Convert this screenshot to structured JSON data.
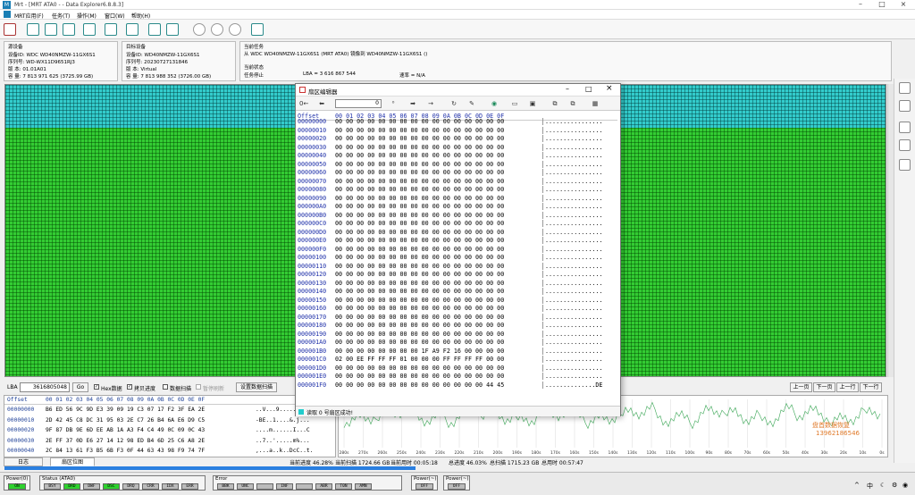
{
  "window": {
    "title": "Mrt - [MRT ATA0 -  - Data Explorer6.8.8.3]"
  },
  "menu": [
    "MRT应用(F)",
    "任务(T)",
    "操作(M)",
    "窗口(W)",
    "帮助(H)"
  ],
  "source": {
    "header": "源设备",
    "device_id": "设备ID: WDC WD40NMZW-11GX6S1",
    "serial": "序列号: WD-WX11D9651RJ3",
    "version": "版    本: 01.01A01",
    "capacity": "容    量: 7 813 971 625 (3725.99 GB)"
  },
  "target": {
    "header": "目标设备",
    "device_id": "设备ID: WD40NMZW-11GX6S1",
    "serial": "序列号: 20230727131846",
    "version": "版    本: Virtual",
    "capacity": "容    量: 7 813 988 352 (3726.00 GB)"
  },
  "task": {
    "header": "当前任务",
    "desc": "从 WDC WD40NMZW-11GX6S1 (MRT ATA0) 镜像到 WD40NMZW-11GX6S1 ()",
    "status_header": "当前状态",
    "status": "任务停止",
    "lba": "LBA = 3 616 867 544",
    "speed": "速率 = N/A"
  },
  "controls": {
    "lba_label": "LBA",
    "lba_value": "3616805048",
    "go": "Go",
    "hex_data": "Hex数据",
    "copy_progress": "拷贝进度",
    "data_scan": "数据扫描",
    "pause_refresh": "暂停刷新",
    "set_scan": "设置数据扫描",
    "prev_page": "上一页",
    "next_page": "下一页",
    "prev_row": "上一行",
    "next_row": "下一行"
  },
  "hex_bottom": {
    "header_offset": "Offset",
    "header_cols": "00 01 02 03 04 05 06 07 08 09 0A 0B 0C 0D 0E 0F",
    "rows": [
      {
        "off": "00000000",
        "hex": "B6 ED 56 9C 9D E3 39 09 19 C3 07 17 F2 3F EA 2E",
        "asc": "..V...9......?.."
      },
      {
        "off": "00000010",
        "hex": "2D 42 45 C8 DC 31 95 03 2E C7 26 B4 6A E6 D9 C5",
        "asc": "-BE..1....&.j..."
      },
      {
        "off": "00000020",
        "hex": "9F 87 DB 9E 6D EE AB 1A A3 F4 C4 49 0C 09 0C 43",
        "asc": "....m......I...C"
      },
      {
        "off": "00000030",
        "hex": "2E FF 37 0D E6 27 14 12 98 ED B4 6D 25 C6 A8 2E",
        "asc": "..7..'.....m%..."
      },
      {
        "off": "00000040",
        "hex": "2C 84 13 61 F3 B5 6B F3 0F 44 63 43 98 F9 74 7F",
        "asc": ",...a..k..DcC..t."
      }
    ]
  },
  "tabs": [
    "日志",
    "扇区位图"
  ],
  "status": {
    "cur_progress": "当前进度  46.28%",
    "cur_scan": "当前扫描  1724.66 GB",
    "cur_time": "当前用时  00:05:18",
    "total_progress": "总进度  46.03%",
    "total_scan": "总扫描  1715.23 GB",
    "total_time": "总用时  00:57:47"
  },
  "graph": {
    "ticks": [
      "280s",
      "270s",
      "260s",
      "250s",
      "240s",
      "230s",
      "220s",
      "210s",
      "200s",
      "190s",
      "180s",
      "170s",
      "160s",
      "150s",
      "140s",
      "130s",
      "120s",
      "110s",
      "100s",
      "90s",
      "80s",
      "70s",
      "60s",
      "50s",
      "40s",
      "30s",
      "20s",
      "10s",
      "0s"
    ],
    "watermark1": "盘首数据恢复",
    "watermark2": "13962186546"
  },
  "bottom": {
    "power0": {
      "title": "Power(0)",
      "leds": [
        "ON"
      ]
    },
    "status": {
      "title": "Status (ATA0)",
      "leds": [
        "BSY",
        "DRD",
        "DWF",
        "DSC",
        "DRQ",
        "CRR",
        "IDX",
        "ERR"
      ]
    },
    "error": {
      "title": "Error",
      "leds": [
        "BBK",
        "UNC",
        "",
        "INF",
        "",
        "ABR",
        "T0N",
        "AMN"
      ]
    },
    "power1": {
      "title": "Power(~)",
      "leds": [
        "OFF"
      ]
    },
    "power2": {
      "title": "Power(~)",
      "leds": [
        "OFF"
      ]
    }
  },
  "dialog": {
    "title": "扇区编辑器",
    "input_value": "0",
    "header_offset": "Offset",
    "header_cols": "00 01 02 03 04 05 06 07 08 09 0A 0B 0C 0D 0E 0F",
    "rows": [
      {
        "off": "00000000",
        "hex": "00 00 00 00 00 00 00 00 00 00 00 00 00 00 00 00",
        "asc": "................"
      },
      {
        "off": "00000010",
        "hex": "00 00 00 00 00 00 00 00 00 00 00 00 00 00 00 00",
        "asc": "................"
      },
      {
        "off": "00000020",
        "hex": "00 00 00 00 00 00 00 00 00 00 00 00 00 00 00 00",
        "asc": "................"
      },
      {
        "off": "00000030",
        "hex": "00 00 00 00 00 00 00 00 00 00 00 00 00 00 00 00",
        "asc": "................"
      },
      {
        "off": "00000040",
        "hex": "00 00 00 00 00 00 00 00 00 00 00 00 00 00 00 00",
        "asc": "................"
      },
      {
        "off": "00000050",
        "hex": "00 00 00 00 00 00 00 00 00 00 00 00 00 00 00 00",
        "asc": "................"
      },
      {
        "off": "00000060",
        "hex": "00 00 00 00 00 00 00 00 00 00 00 00 00 00 00 00",
        "asc": "................"
      },
      {
        "off": "00000070",
        "hex": "00 00 00 00 00 00 00 00 00 00 00 00 00 00 00 00",
        "asc": "................"
      },
      {
        "off": "00000080",
        "hex": "00 00 00 00 00 00 00 00 00 00 00 00 00 00 00 00",
        "asc": "................"
      },
      {
        "off": "00000090",
        "hex": "00 00 00 00 00 00 00 00 00 00 00 00 00 00 00 00",
        "asc": "................"
      },
      {
        "off": "000000A0",
        "hex": "00 00 00 00 00 00 00 00 00 00 00 00 00 00 00 00",
        "asc": "................"
      },
      {
        "off": "000000B0",
        "hex": "00 00 00 00 00 00 00 00 00 00 00 00 00 00 00 00",
        "asc": "................"
      },
      {
        "off": "000000C0",
        "hex": "00 00 00 00 00 00 00 00 00 00 00 00 00 00 00 00",
        "asc": "................"
      },
      {
        "off": "000000D0",
        "hex": "00 00 00 00 00 00 00 00 00 00 00 00 00 00 00 00",
        "asc": "................"
      },
      {
        "off": "000000E0",
        "hex": "00 00 00 00 00 00 00 00 00 00 00 00 00 00 00 00",
        "asc": "................"
      },
      {
        "off": "000000F0",
        "hex": "00 00 00 00 00 00 00 00 00 00 00 00 00 00 00 00",
        "asc": "................"
      },
      {
        "off": "00000100",
        "hex": "00 00 00 00 00 00 00 00 00 00 00 00 00 00 00 00",
        "asc": "................"
      },
      {
        "off": "00000110",
        "hex": "00 00 00 00 00 00 00 00 00 00 00 00 00 00 00 00",
        "asc": "................"
      },
      {
        "off": "00000120",
        "hex": "00 00 00 00 00 00 00 00 00 00 00 00 00 00 00 00",
        "asc": "................"
      },
      {
        "off": "00000130",
        "hex": "00 00 00 00 00 00 00 00 00 00 00 00 00 00 00 00",
        "asc": "................"
      },
      {
        "off": "00000140",
        "hex": "00 00 00 00 00 00 00 00 00 00 00 00 00 00 00 00",
        "asc": "................"
      },
      {
        "off": "00000150",
        "hex": "00 00 00 00 00 00 00 00 00 00 00 00 00 00 00 00",
        "asc": "................"
      },
      {
        "off": "00000160",
        "hex": "00 00 00 00 00 00 00 00 00 00 00 00 00 00 00 00",
        "asc": "................"
      },
      {
        "off": "00000170",
        "hex": "00 00 00 00 00 00 00 00 00 00 00 00 00 00 00 00",
        "asc": "................"
      },
      {
        "off": "00000180",
        "hex": "00 00 00 00 00 00 00 00 00 00 00 00 00 00 00 00",
        "asc": "................"
      },
      {
        "off": "00000190",
        "hex": "00 00 00 00 00 00 00 00 00 00 00 00 00 00 00 00",
        "asc": "................"
      },
      {
        "off": "000001A0",
        "hex": "00 00 00 00 00 00 00 00 00 00 00 00 00 00 00 00",
        "asc": "................"
      },
      {
        "off": "000001B0",
        "hex": "00 00 00 00 00 00 00 00 1F A9 F2 16 00 00 00 00",
        "asc": "................"
      },
      {
        "off": "000001C0",
        "hex": "02 00 EE FF FF FF 01 00 00 00 FF FF FF FF 00 00",
        "asc": "................"
      },
      {
        "off": "000001D0",
        "hex": "00 00 00 00 00 00 00 00 00 00 00 00 00 00 00 00",
        "asc": "................"
      },
      {
        "off": "000001E0",
        "hex": "00 00 00 00 00 00 00 00 00 00 00 00 00 00 00 00",
        "asc": "................"
      },
      {
        "off": "000001F0",
        "hex": "00 00 00 00 00 00 00 00 00 00 00 00 00 00 44 45",
        "asc": "..............DE"
      }
    ],
    "status": "读取 0 号扇区成功!"
  },
  "tray": {
    "lang": "中"
  }
}
